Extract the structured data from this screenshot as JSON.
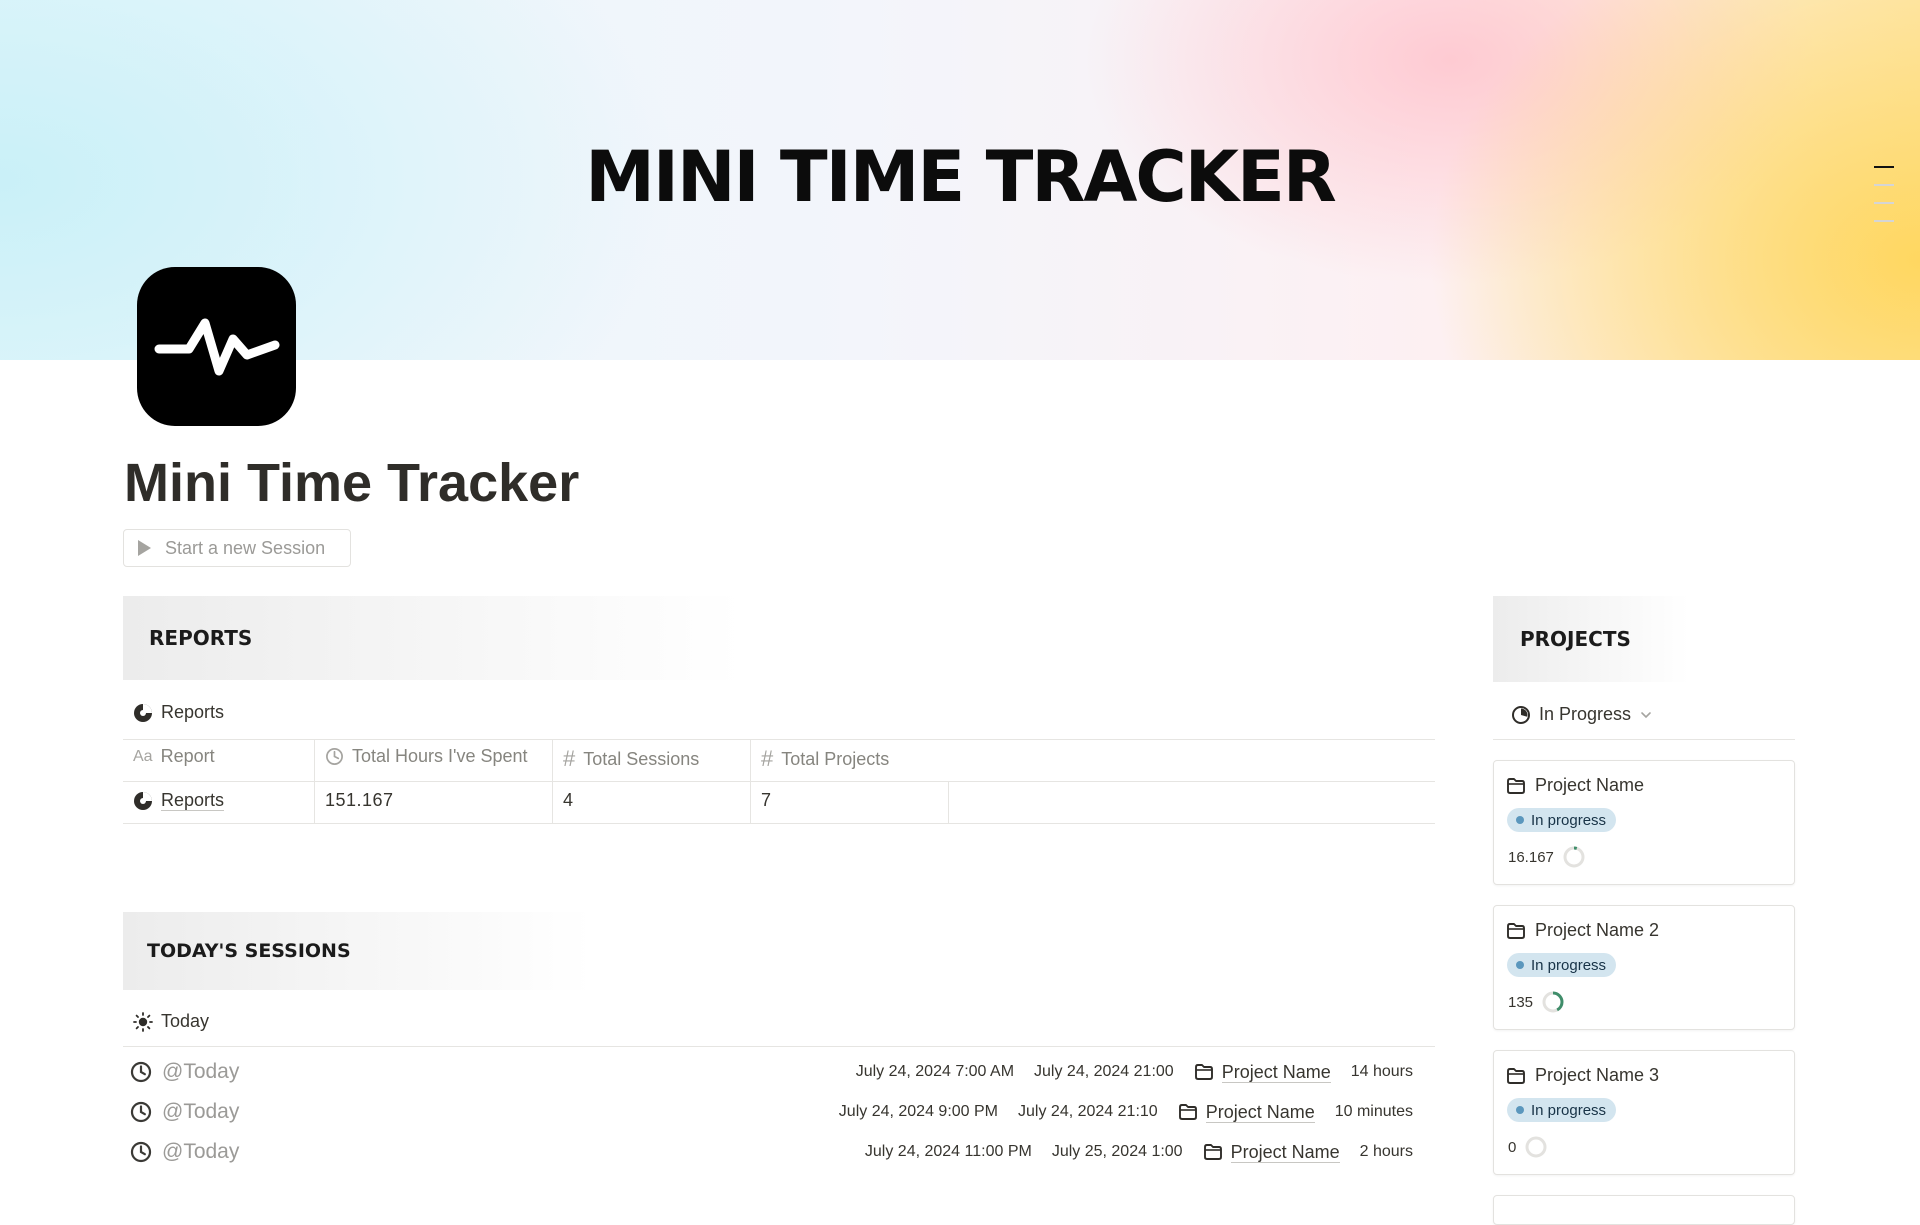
{
  "cover": {
    "title": "MINI TIME TRACKER"
  },
  "page": {
    "title": "Mini Time Tracker",
    "start_session_label": "Start a new Session"
  },
  "reports": {
    "section_title": "REPORTS",
    "view_tab": "Reports",
    "columns": [
      "Report",
      "Total Hours I've Spent",
      "Total Sessions",
      "Total Projects"
    ],
    "rows": [
      {
        "report": "Reports",
        "total_hours": "151.167",
        "total_sessions": "4",
        "total_projects": "7"
      }
    ]
  },
  "todays_sessions": {
    "section_title": "TODAY'S SESSIONS",
    "view_tab": "Today",
    "rows": [
      {
        "name": "@Today",
        "start": "July 24, 2024 7:00 AM",
        "end": "July 24, 2024 21:00",
        "project": "Project Name",
        "duration": "14 hours"
      },
      {
        "name": "@Today",
        "start": "July 24, 2024 9:00 PM",
        "end": "July 24, 2024 21:10",
        "project": "Project Name",
        "duration": "10 minutes"
      },
      {
        "name": "@Today",
        "start": "July 24, 2024 11:00 PM",
        "end": "July 25, 2024 1:00",
        "project": "Project Name",
        "duration": "2 hours"
      }
    ]
  },
  "projects": {
    "section_title": "PROJECTS",
    "filter_label": "In Progress",
    "cards": [
      {
        "name": "Project Name",
        "status": "In progress",
        "hours": "16.167",
        "progress": 0.05
      },
      {
        "name": "Project Name 2",
        "status": "In progress",
        "hours": "135",
        "progress": 0.42
      },
      {
        "name": "Project Name 3",
        "status": "In progress",
        "hours": "0",
        "progress": 0
      }
    ]
  },
  "colors": {
    "status_badge_bg": "#d3e5ef",
    "status_dot": "#5b97bd",
    "progress_ring": "#3f8d6a"
  },
  "icons": {
    "page_icon": "activity-pulse-icon",
    "reports_tab": "pie-chart-icon",
    "today_tab": "sun-icon",
    "filter": "progress-circle-icon",
    "project": "folder-icon",
    "session": "clock-icon"
  }
}
